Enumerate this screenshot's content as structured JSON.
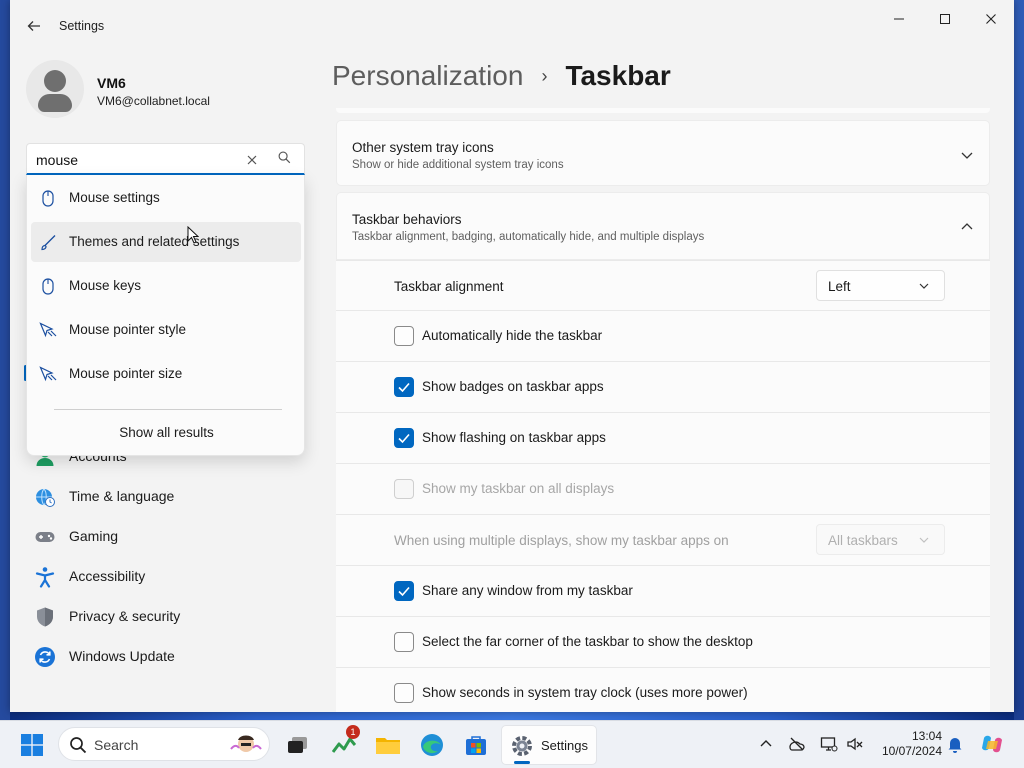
{
  "window": {
    "app_title": "Settings",
    "controls": {
      "minimize": "—",
      "maximize": "☐",
      "close": "✕"
    }
  },
  "profile": {
    "name": "VM6",
    "email": "VM6@collabnet.local"
  },
  "search": {
    "value": "mouse",
    "suggestions": [
      {
        "label": "Mouse settings",
        "icon": "mouse-icon"
      },
      {
        "label": "Themes and related settings",
        "icon": "brush-icon"
      },
      {
        "label": "Mouse keys",
        "icon": "mouse-icon"
      },
      {
        "label": "Mouse pointer style",
        "icon": "pointer-icon"
      },
      {
        "label": "Mouse pointer size",
        "icon": "pointer-icon"
      }
    ],
    "show_all": "Show all results"
  },
  "nav": {
    "items": [
      {
        "label": "Accounts",
        "icon": "accounts-icon"
      },
      {
        "label": "Time & language",
        "icon": "globe-clock-icon"
      },
      {
        "label": "Gaming",
        "icon": "gamepad-icon"
      },
      {
        "label": "Accessibility",
        "icon": "accessibility-icon"
      },
      {
        "label": "Privacy & security",
        "icon": "shield-icon"
      },
      {
        "label": "Windows Update",
        "icon": "update-icon"
      }
    ]
  },
  "breadcrumb": {
    "parent": "Personalization",
    "separator": "›",
    "current": "Taskbar"
  },
  "cards": {
    "tray_icons": {
      "title": "Other system tray icons",
      "subtitle": "Show or hide additional system tray icons"
    },
    "behaviors": {
      "title": "Taskbar behaviors",
      "subtitle": "Taskbar alignment, badging, automatically hide, and multiple displays"
    }
  },
  "behaviors": {
    "alignment_label": "Taskbar alignment",
    "alignment_value": "Left",
    "auto_hide": {
      "label": "Automatically hide the taskbar",
      "checked": false
    },
    "badges": {
      "label": "Show badges on taskbar apps",
      "checked": true
    },
    "flashing": {
      "label": "Show flashing on taskbar apps",
      "checked": true
    },
    "all_displays": {
      "label": "Show my taskbar on all displays",
      "checked": false,
      "disabled": true
    },
    "multi_label": "When using multiple displays, show my taskbar apps on",
    "multi_value": "All taskbars",
    "share_window": {
      "label": "Share any window from my taskbar",
      "checked": true
    },
    "far_corner": {
      "label": "Select the far corner of the taskbar to show the desktop",
      "checked": false
    },
    "show_seconds": {
      "label": "Show seconds in system tray clock (uses more power)",
      "checked": false
    }
  },
  "taskbar": {
    "search_label": "Search",
    "settings_label": "Settings",
    "badge_count": "1",
    "time": "13:04",
    "date": "10/07/2024",
    "accent": "#0067c0"
  }
}
